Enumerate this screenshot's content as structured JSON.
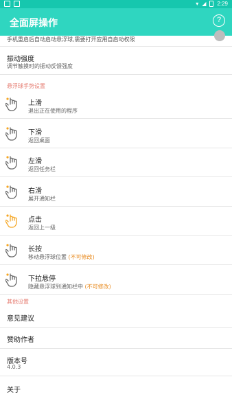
{
  "status_bar": {
    "time": "2:29"
  },
  "app_bar": {
    "title": "全面屏操作",
    "help_icon": "?"
  },
  "top_partial": {
    "description": "手机重启后自动启动悬浮球,需要打开应用自启动权限"
  },
  "vibration": {
    "title": "振动强度",
    "summary": "调节触摸时的振动反馈强度"
  },
  "gesture_section": {
    "header": "悬浮球手势设置"
  },
  "gestures": [
    {
      "title": "上滑",
      "summary": "退出正在使用的程序",
      "note": ""
    },
    {
      "title": "下滑",
      "summary": "返回桌面",
      "note": ""
    },
    {
      "title": "左滑",
      "summary": "返回任务栏",
      "note": ""
    },
    {
      "title": "右滑",
      "summary": "展开通知栏",
      "note": ""
    },
    {
      "title": "点击",
      "summary": "返回上一级",
      "note": ""
    },
    {
      "title": "长按",
      "summary": "移动悬浮球位置 ",
      "note": "(不可修改)"
    },
    {
      "title": "下拉悬停",
      "summary": "隐藏悬浮球到通知栏中 ",
      "note": "(不可修改)"
    }
  ],
  "other_section": {
    "header": "其他设置"
  },
  "other": {
    "feedback": "意见建议",
    "donate": "赞助作者",
    "version_title": "版本号",
    "version_value": "4.0.3",
    "about": "关于"
  },
  "colors": {
    "status_bar": "#16c7ae",
    "app_bar": "#2fd6c0",
    "section_header": "#e67e73",
    "note": "#e8891c",
    "hand_orange": "#f5a623"
  }
}
